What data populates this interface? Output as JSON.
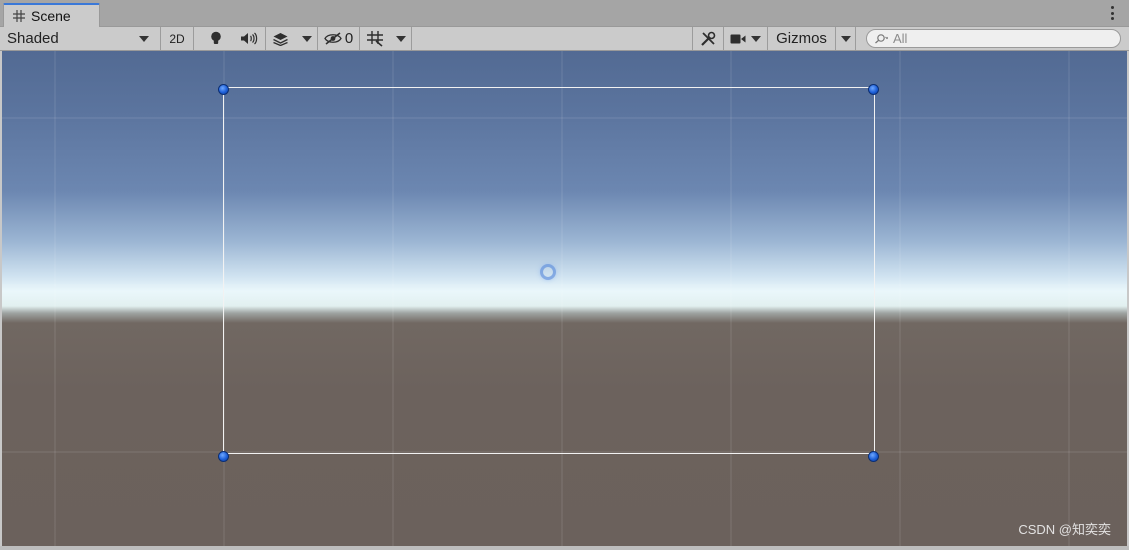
{
  "tab": {
    "title": "Scene"
  },
  "toolbar": {
    "shading_mode": "Shaded",
    "mode_2d": "2D",
    "hidden_count": "0",
    "gizmos": "Gizmos",
    "search_placeholder": "All"
  },
  "icons": {
    "tab": "grid-hash-icon",
    "light": "lightbulb-icon",
    "audio": "speaker-icon",
    "effects": "layers-icon",
    "hidden": "eye-slash-icon",
    "grid": "grid-snap-icon",
    "tools": "tools-icon",
    "camera": "video-camera-icon",
    "search": "search-icon",
    "menu": "kebab-menu-icon"
  },
  "colors": {
    "selection_handle": "#1d5fd8",
    "tab_accent": "#3a78d8",
    "rect_outline": "#f2f2f2"
  },
  "watermark": "CSDN @知奕奕"
}
